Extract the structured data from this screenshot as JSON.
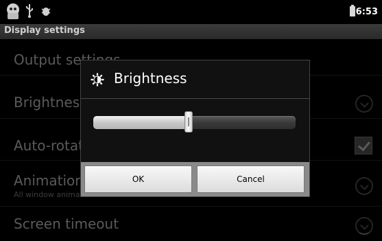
{
  "status_bar": {
    "time": "6:53",
    "icons": [
      "android-robot-icon",
      "usb-icon",
      "debug-bug-icon",
      "battery-icon"
    ]
  },
  "title_bar": {
    "title": "Display settings"
  },
  "settings": {
    "items": [
      {
        "title": "Output settings",
        "subtitle": ""
      },
      {
        "title": "Brightness",
        "subtitle": ""
      },
      {
        "title": "Auto-rotate screen",
        "subtitle": "",
        "checked": true
      },
      {
        "title": "Animation",
        "subtitle": "All window animations are shown"
      },
      {
        "title": "Screen timeout",
        "subtitle": ""
      }
    ]
  },
  "dialog": {
    "title": "Brightness",
    "icon": "brightness-sun-icon",
    "slider_value": 0.47,
    "ok_label": "OK",
    "cancel_label": "Cancel"
  }
}
